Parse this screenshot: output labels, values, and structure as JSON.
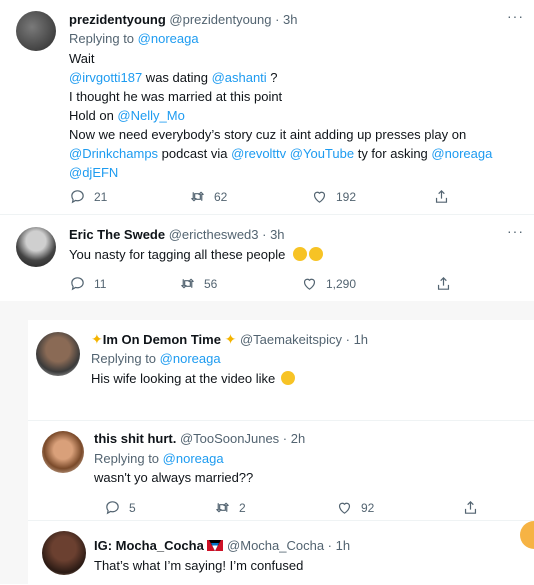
{
  "tweet1": {
    "name": "prezidentyoung",
    "meta": "@prezidentyoung · 3h",
    "replying_prefix": "Replying to ",
    "replying_to": "@noreaga",
    "body": {
      "l1": "Wait",
      "l2a": "@irvgotti187",
      "l2b": " was dating ",
      "l2c": "@ashanti",
      "l2d": " ?",
      "l3": "I thought he was married at this point",
      "l4a": "Hold on ",
      "l4b": "@Nelly_Mo",
      "l5": "Now we need everybody’s story cuz it aint adding up presses play on",
      "l6a": "@Drinkchamps",
      "l6b": " podcast via ",
      "l6c": "@revolttv",
      "l6d": " ",
      "l6e": "@YouTube",
      "l6f": " ty for asking ",
      "l6g": "@noreaga",
      "l7": "@djEFN"
    },
    "replies": "21",
    "retweets": "62",
    "likes": "192"
  },
  "tweet2": {
    "name": "Eric The Swede",
    "meta": "@erictheswed3 · 3h",
    "text": "You nasty for tagging all these people",
    "replies": "11",
    "retweets": "56",
    "likes": "1,290"
  },
  "tweet3": {
    "name": "Im On Demon Time",
    "meta": "@Taemakeitspicy · 1h",
    "replying_prefix": "Replying to ",
    "replying_to": "@noreaga",
    "text": "His wife looking at the video like"
  },
  "tweet4": {
    "name": "this shit hurt.",
    "meta": "@TooSoonJunes · 2h",
    "replying_prefix": "Replying to ",
    "replying_to": "@noreaga",
    "text": "wasn't yo always married??",
    "replies": "5",
    "retweets": "2",
    "likes": "92"
  },
  "tweet5": {
    "name": "IG: Mocha_Cocha",
    "meta": "@Mocha_Cocha · 1h",
    "text": "That’s what I’m saying! I’m confused"
  },
  "colors": {
    "link": "#1d9bf0",
    "muted": "#536471",
    "text": "#0f1419"
  }
}
